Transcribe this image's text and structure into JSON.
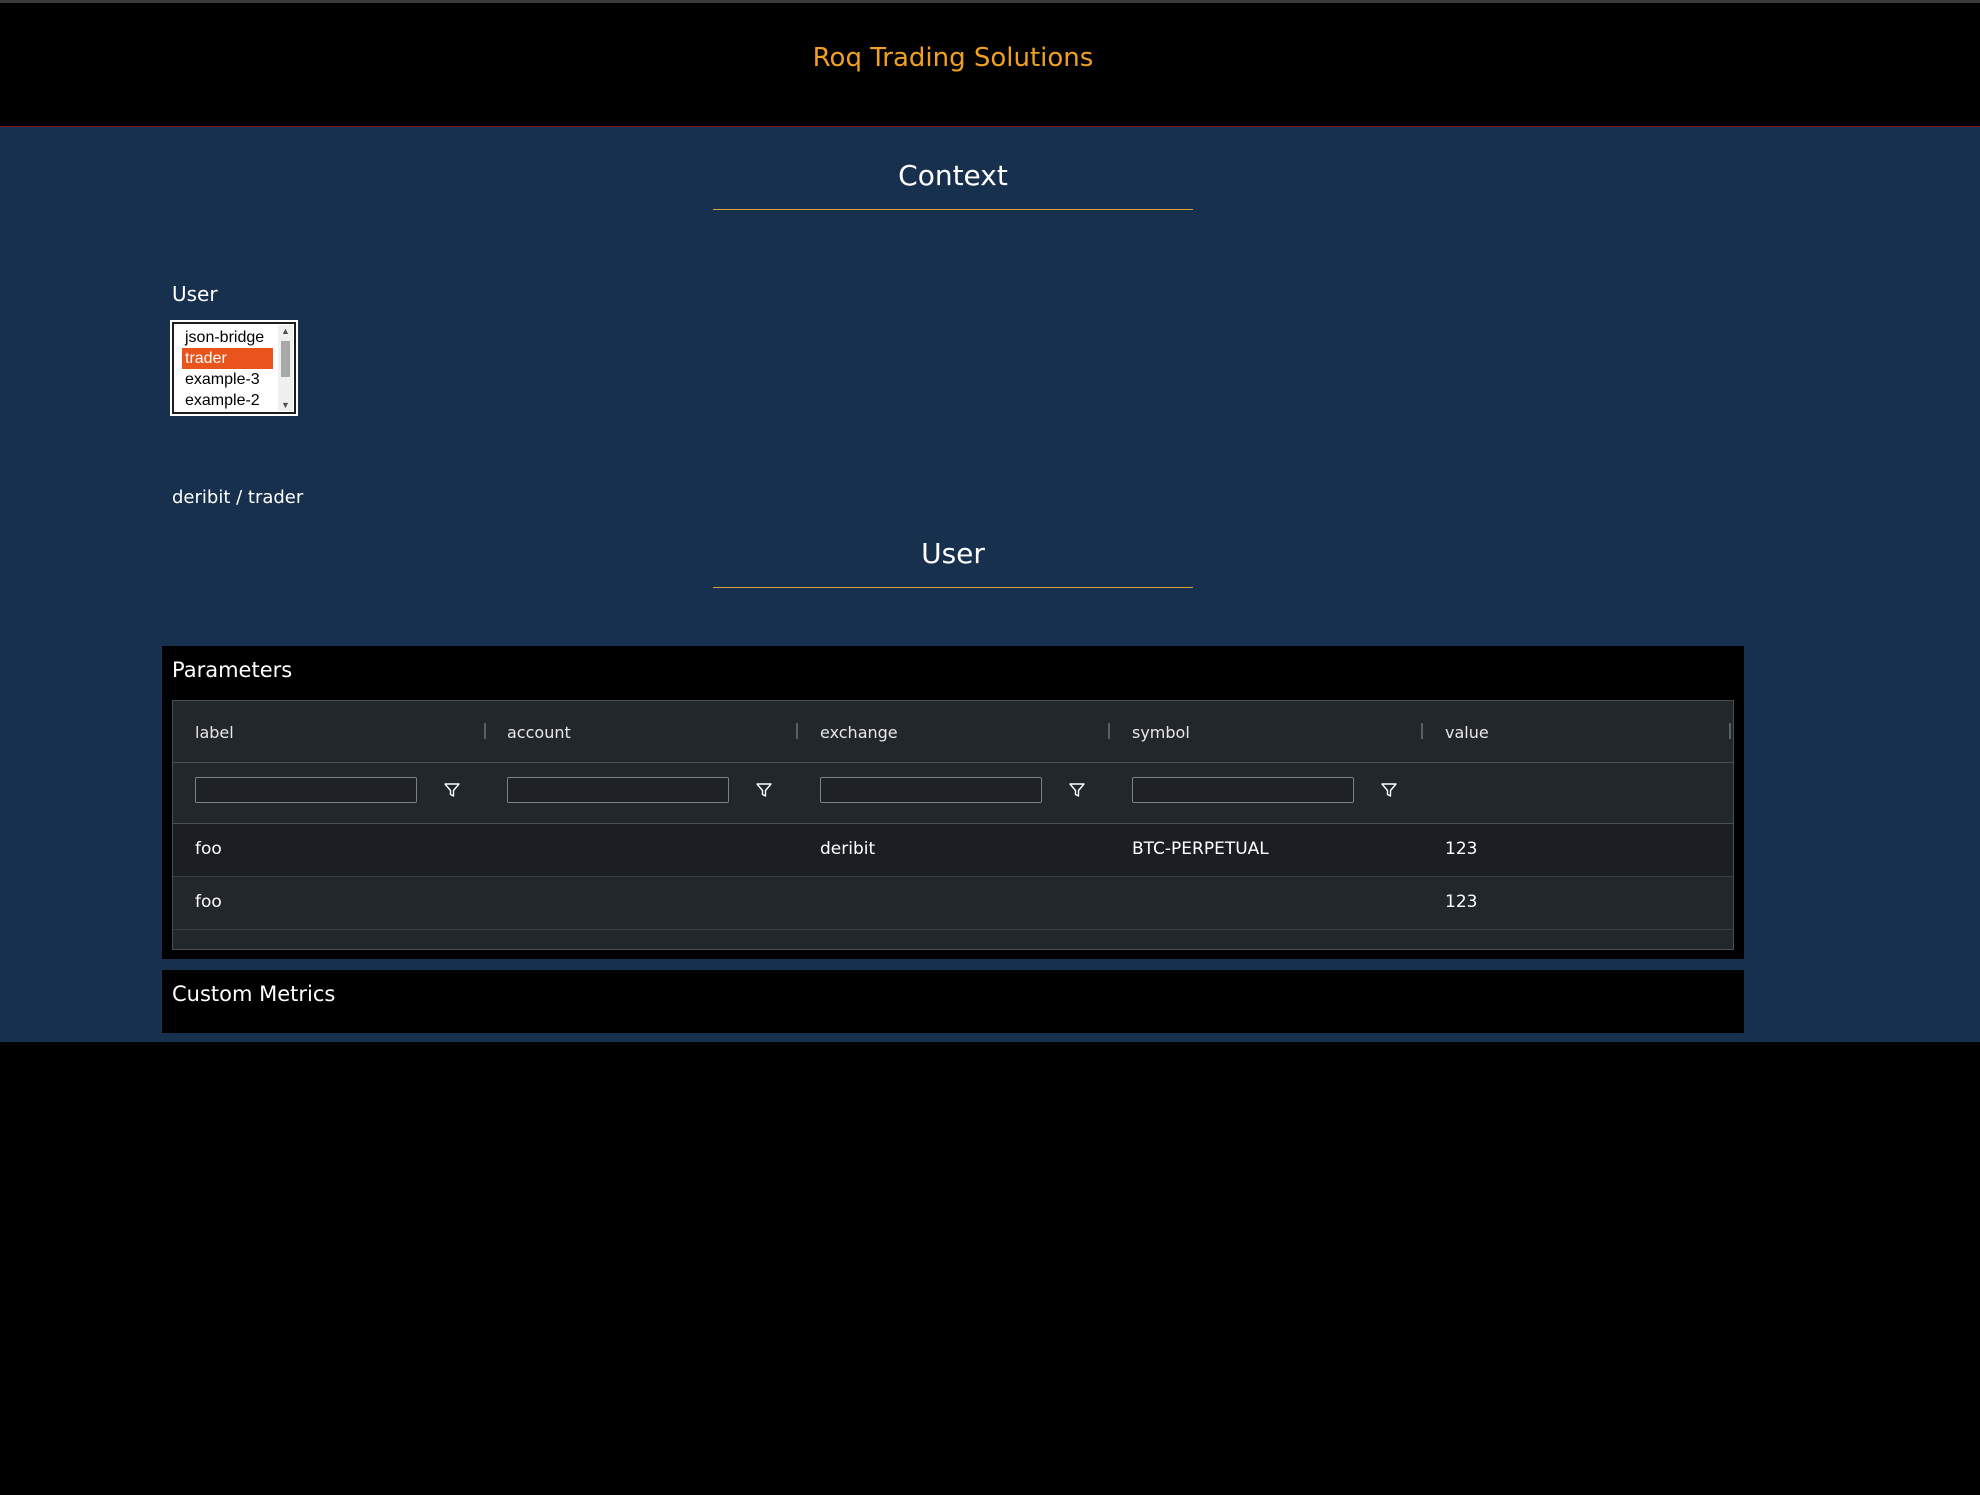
{
  "app": {
    "brand": "Roq Trading Solutions"
  },
  "context_section": {
    "title": "Context",
    "user_label": "User",
    "user_options": [
      "json-bridge",
      "trader",
      "example-3",
      "example-2"
    ],
    "selected_user": "trader",
    "current_context": "deribit / trader"
  },
  "user_section": {
    "title": "User"
  },
  "parameters": {
    "title": "Parameters",
    "columns": [
      "label",
      "account",
      "exchange",
      "symbol",
      "value"
    ],
    "filters": [
      "",
      "",
      "",
      ""
    ],
    "rows": [
      {
        "label": "foo",
        "account": "",
        "exchange": "deribit",
        "symbol": "BTC-PERPETUAL",
        "value": "123"
      },
      {
        "label": "foo",
        "account": "",
        "exchange": "",
        "symbol": "",
        "value": "123"
      }
    ]
  },
  "custom_metrics": {
    "title": "Custom Metrics"
  },
  "colors": {
    "brand": "#f0a020",
    "background": "#17304e",
    "selected_option": "#e8541c",
    "title_rule": "#d4a040"
  },
  "icons": {
    "filter": "filter-icon",
    "scroll_up": "scroll-up-arrow-icon",
    "scroll_down": "scroll-down-arrow-icon"
  }
}
